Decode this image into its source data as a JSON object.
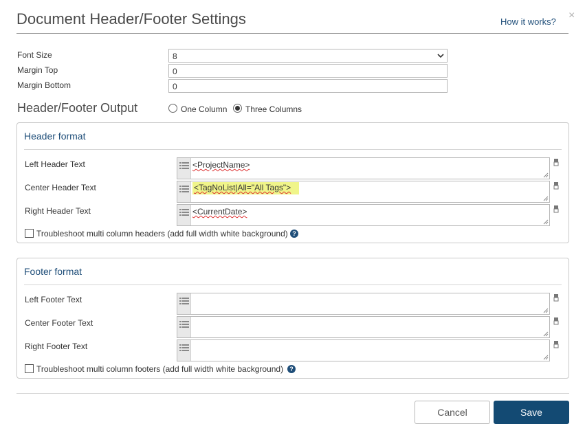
{
  "dialog": {
    "title": "Document Header/Footer Settings",
    "help_link": "How it works?",
    "close_glyph": "×"
  },
  "settings": {
    "font_size_label": "Font Size",
    "font_size_value": "8",
    "margin_top_label": "Margin Top",
    "margin_top_value": "0",
    "margin_bottom_label": "Margin Bottom",
    "margin_bottom_value": "0"
  },
  "output": {
    "label": "Header/Footer Output",
    "options": [
      {
        "label": "One Column",
        "selected": false
      },
      {
        "label": "Three Columns",
        "selected": true
      }
    ]
  },
  "header": {
    "title": "Header format",
    "rows": [
      {
        "label": "Left Header Text",
        "value": "<ProjectName>"
      },
      {
        "label": "Center Header Text",
        "value": "<TagNoList|All=\"All Tags\">"
      },
      {
        "label": "Right Header Text",
        "value": "<CurrentDate>"
      }
    ],
    "troubleshoot_label": "Troubleshoot multi column headers (add full width white background)"
  },
  "footer": {
    "title": "Footer format",
    "rows": [
      {
        "label": "Left Footer Text",
        "value": ""
      },
      {
        "label": "Center Footer Text",
        "value": ""
      },
      {
        "label": "Right Footer Text",
        "value": ""
      }
    ],
    "troubleshoot_label": "Troubleshoot multi column footers (add full width white background)"
  },
  "buttons": {
    "cancel": "Cancel",
    "save": "Save"
  },
  "colors": {
    "accent": "#134a73",
    "link": "#1f4e79",
    "highlight": "#f0f58a"
  },
  "icons": [
    "list-icon",
    "eraser-icon",
    "help-icon",
    "chevron-down-icon",
    "close-icon"
  ]
}
